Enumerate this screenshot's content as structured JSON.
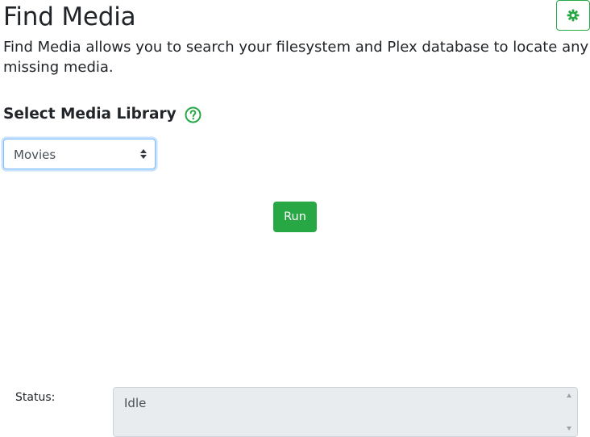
{
  "header": {
    "title": "Find Media",
    "settings_icon": "gear-icon"
  },
  "description": "Find Media allows you to search your filesystem and Plex database to locate any missing media.",
  "library_section": {
    "heading": "Select Media Library",
    "help_icon": "question-circle-icon",
    "selected_value": "Movies"
  },
  "actions": {
    "run_label": "Run"
  },
  "status": {
    "label": "Status:",
    "value": "Idle"
  },
  "colors": {
    "success": "#28a745",
    "focus_border": "#80bdff",
    "readonly_bg": "#e9ecef"
  }
}
